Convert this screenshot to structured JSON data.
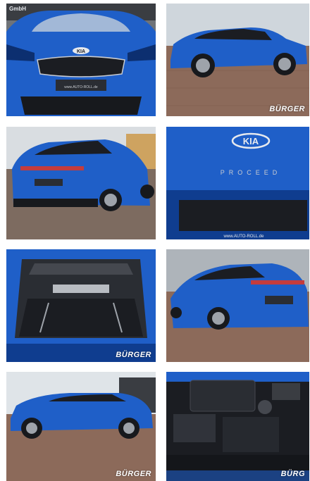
{
  "gallery": {
    "colors": {
      "car_blue": "#1f5fc8",
      "car_blue_dark": "#0f3d8f",
      "paving": "#8c6a5a",
      "sky": "#cfd6dc"
    },
    "tiles": [
      {
        "id": "front",
        "watermark": "",
        "sign": "GmbH",
        "badge": "KIA",
        "plate": "www.AUTO-ROLL.de"
      },
      {
        "id": "side-right",
        "watermark": "BÜRGER",
        "sign": "",
        "badge": "",
        "plate": ""
      },
      {
        "id": "rear-left",
        "watermark": "",
        "sign": "",
        "badge": "",
        "plate": ""
      },
      {
        "id": "rear-badge",
        "watermark": "",
        "sign": "",
        "badge": "KIA",
        "model": "PROCEED",
        "plate": "www.AUTO-ROLL.de"
      },
      {
        "id": "trunk",
        "watermark": "BÜRGER",
        "sign": "",
        "badge": "",
        "plate": ""
      },
      {
        "id": "rear-right",
        "watermark": "",
        "sign": "",
        "badge": "",
        "plate": ""
      },
      {
        "id": "side-left",
        "watermark": "BÜRGER",
        "sign": "",
        "badge": "",
        "plate": ""
      },
      {
        "id": "engine-bay",
        "watermark": "BÜRG",
        "sign": "",
        "badge": "",
        "plate": ""
      }
    ]
  }
}
